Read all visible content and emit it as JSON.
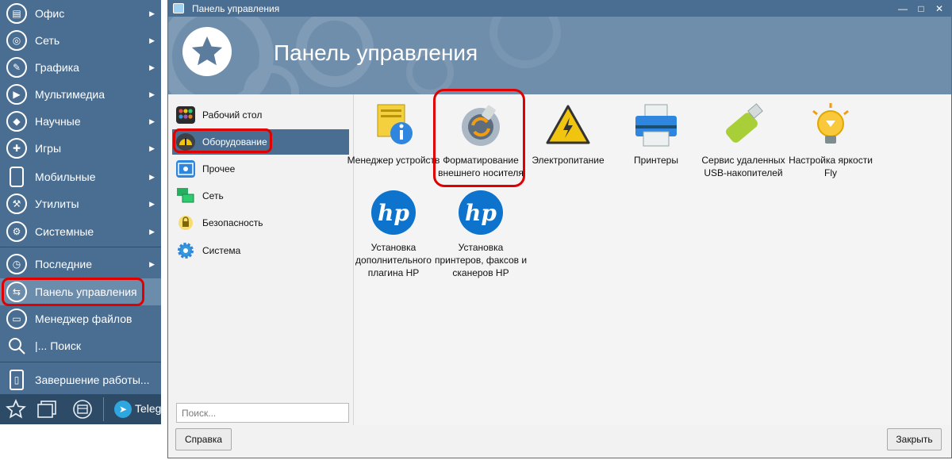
{
  "start_menu": {
    "items": [
      {
        "label": "Офис",
        "icon": "office-icon",
        "has_submenu": true
      },
      {
        "label": "Сеть",
        "icon": "network-icon",
        "has_submenu": true
      },
      {
        "label": "Графика",
        "icon": "graphics-icon",
        "has_submenu": true
      },
      {
        "label": "Мультимедиа",
        "icon": "multimedia-icon",
        "has_submenu": true
      },
      {
        "label": "Научные",
        "icon": "science-icon",
        "has_submenu": true
      },
      {
        "label": "Игры",
        "icon": "games-icon",
        "has_submenu": true
      },
      {
        "label": "Мобильные",
        "icon": "mobile-icon",
        "has_submenu": true
      },
      {
        "label": "Утилиты",
        "icon": "utilities-icon",
        "has_submenu": true
      },
      {
        "label": "Системные",
        "icon": "system-icon",
        "has_submenu": true
      },
      {
        "label": "Последние",
        "icon": "recent-icon",
        "has_submenu": true
      },
      {
        "label": "Панель управления",
        "icon": "control-panel-icon",
        "has_submenu": false
      },
      {
        "label": "Менеджер файлов",
        "icon": "file-manager-icon",
        "has_submenu": false
      },
      {
        "label": "|... Поиск",
        "icon": "search-icon",
        "has_submenu": false
      },
      {
        "label": "Завершение работы...",
        "icon": "shutdown-icon",
        "has_submenu": false
      }
    ]
  },
  "taskbar": {
    "telegram_label": "Teleg"
  },
  "window": {
    "title": "Панель управления",
    "banner_title": "Панель управления",
    "categories": [
      {
        "label": "Рабочий стол",
        "icon": "desktop-icon"
      },
      {
        "label": "Оборудование",
        "icon": "hardware-icon"
      },
      {
        "label": "Прочее",
        "icon": "other-icon"
      },
      {
        "label": "Сеть",
        "icon": "network-icon"
      },
      {
        "label": "Безопасность",
        "icon": "security-icon"
      },
      {
        "label": "Система",
        "icon": "system-gear-icon"
      }
    ],
    "search_placeholder": "Поиск...",
    "tiles": [
      {
        "label": "Менеджер устройств",
        "icon": "device-manager-icon"
      },
      {
        "label": "Форматирование внешнего носителя",
        "icon": "usb-format-icon"
      },
      {
        "label": "Электропитание",
        "icon": "power-warning-icon"
      },
      {
        "label": "Принтеры",
        "icon": "printer-icon"
      },
      {
        "label": "Сервис удаленных USB-накопителей",
        "icon": "usb-drive-icon"
      },
      {
        "label": "Настройка яркости Fly",
        "icon": "lightbulb-icon"
      },
      {
        "label": "Установка дополнительного плагина HP",
        "icon": "hp-logo-icon"
      },
      {
        "label": "Установка принтеров, факсов и сканеров HP",
        "icon": "hp-logo-icon"
      }
    ],
    "help_button": "Справка",
    "close_button": "Закрыть"
  },
  "colors": {
    "menu_bg": "#4a6e92",
    "banner_bg": "#6f8eab",
    "selection": "#4a6e92",
    "highlight_ring": "#e00000",
    "taskbar_bg": "#2d4a66"
  }
}
